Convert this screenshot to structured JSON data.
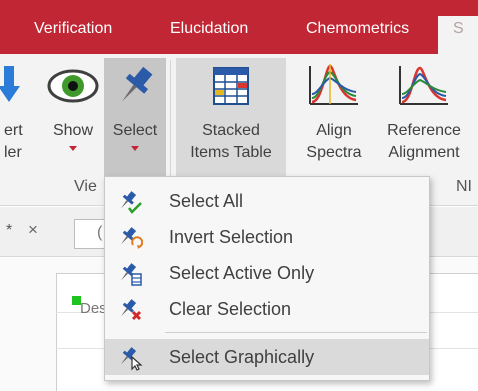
{
  "ribbon_tabs": [
    "Verification",
    "Elucidation",
    "Chemometrics",
    "S"
  ],
  "ribbon": {
    "partial_button": {
      "line1": "ert",
      "line2": "ler"
    },
    "show_button": {
      "label": "Show"
    },
    "select_button": {
      "label": "Select"
    },
    "stacked_button": {
      "line1": "Stacked",
      "line2": "Items Table"
    },
    "align_button": {
      "line1": "Align",
      "line2": "Spectra"
    },
    "reference_button": {
      "line1": "Reference",
      "line2": "Alignment"
    },
    "group_view": "Vie",
    "group_nm": "NI"
  },
  "document": {
    "tab_mark": "*",
    "close_glyph": "×",
    "input_value": "(",
    "row_text": "Des"
  },
  "menu": {
    "items": [
      {
        "label": "Select All",
        "icon": "select-all-icon"
      },
      {
        "label": "Invert Selection",
        "icon": "invert-selection-icon"
      },
      {
        "label": "Select Active Only",
        "icon": "select-active-only-icon"
      },
      {
        "label": "Clear Selection",
        "icon": "clear-selection-icon"
      },
      {
        "label": "Select Graphically",
        "icon": "select-graphically-icon"
      }
    ]
  },
  "colors": {
    "ribbon_red": "#c12634",
    "pin_blue": "#2a5aa8",
    "check_green": "#28a028",
    "clear_red": "#d12a2a",
    "selected_button_bg": "#c6c6c6",
    "menu_highlight": "#dadada"
  }
}
